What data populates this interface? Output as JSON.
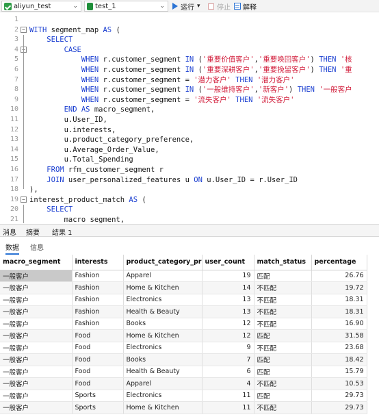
{
  "toolbar": {
    "connection": "aliyun_test",
    "database": "test_1",
    "run_label": "运行",
    "run_dropdown": "▾",
    "stop_label": "停止",
    "explain_label": "解释"
  },
  "editor": {
    "lines": [
      {
        "n": "1",
        "tokens": []
      },
      {
        "n": "2",
        "tokens": [
          {
            "t": "WITH",
            "c": "kw"
          },
          {
            "t": " segment_map ",
            "c": "plain"
          },
          {
            "t": "AS",
            "c": "kw"
          },
          {
            "t": " (",
            "c": "plain"
          }
        ]
      },
      {
        "n": "3",
        "tokens": [
          {
            "t": "    ",
            "c": "plain"
          },
          {
            "t": "SELECT",
            "c": "kw"
          }
        ]
      },
      {
        "n": "4",
        "tokens": [
          {
            "t": "        ",
            "c": "plain"
          },
          {
            "t": "CASE",
            "c": "kw"
          }
        ]
      },
      {
        "n": "5",
        "tokens": [
          {
            "t": "            ",
            "c": "plain"
          },
          {
            "t": "WHEN",
            "c": "kw"
          },
          {
            "t": " r.customer_segment ",
            "c": "plain"
          },
          {
            "t": "IN",
            "c": "kw"
          },
          {
            "t": " (",
            "c": "plain"
          },
          {
            "t": "'重要价值客户'",
            "c": "str"
          },
          {
            "t": ",",
            "c": "plain"
          },
          {
            "t": "'重要唤回客户'",
            "c": "str"
          },
          {
            "t": ") ",
            "c": "plain"
          },
          {
            "t": "THEN",
            "c": "kw"
          },
          {
            "t": " ",
            "c": "plain"
          },
          {
            "t": "'核",
            "c": "str"
          }
        ]
      },
      {
        "n": "6",
        "tokens": [
          {
            "t": "            ",
            "c": "plain"
          },
          {
            "t": "WHEN",
            "c": "kw"
          },
          {
            "t": " r.customer_segment ",
            "c": "plain"
          },
          {
            "t": "IN",
            "c": "kw"
          },
          {
            "t": " (",
            "c": "plain"
          },
          {
            "t": "'重要深耕客户'",
            "c": "str"
          },
          {
            "t": ",",
            "c": "plain"
          },
          {
            "t": "'重要挽留客户'",
            "c": "str"
          },
          {
            "t": ") ",
            "c": "plain"
          },
          {
            "t": "THEN",
            "c": "kw"
          },
          {
            "t": " ",
            "c": "plain"
          },
          {
            "t": "'重",
            "c": "str"
          }
        ]
      },
      {
        "n": "7",
        "tokens": [
          {
            "t": "            ",
            "c": "plain"
          },
          {
            "t": "WHEN",
            "c": "kw"
          },
          {
            "t": " r.customer_segment = ",
            "c": "plain"
          },
          {
            "t": "'潜力客户'",
            "c": "str"
          },
          {
            "t": " ",
            "c": "plain"
          },
          {
            "t": "THEN",
            "c": "kw"
          },
          {
            "t": " ",
            "c": "plain"
          },
          {
            "t": "'潜力客户'",
            "c": "str"
          }
        ]
      },
      {
        "n": "8",
        "tokens": [
          {
            "t": "            ",
            "c": "plain"
          },
          {
            "t": "WHEN",
            "c": "kw"
          },
          {
            "t": " r.customer_segment ",
            "c": "plain"
          },
          {
            "t": "IN",
            "c": "kw"
          },
          {
            "t": " (",
            "c": "plain"
          },
          {
            "t": "'一般维持客户'",
            "c": "str"
          },
          {
            "t": ",",
            "c": "plain"
          },
          {
            "t": "'新客户'",
            "c": "str"
          },
          {
            "t": ") ",
            "c": "plain"
          },
          {
            "t": "THEN",
            "c": "kw"
          },
          {
            "t": " ",
            "c": "plain"
          },
          {
            "t": "'一般客户",
            "c": "str"
          }
        ]
      },
      {
        "n": "9",
        "tokens": [
          {
            "t": "            ",
            "c": "plain"
          },
          {
            "t": "WHEN",
            "c": "kw"
          },
          {
            "t": " r.customer_segment = ",
            "c": "plain"
          },
          {
            "t": "'流失客户'",
            "c": "str"
          },
          {
            "t": " ",
            "c": "plain"
          },
          {
            "t": "THEN",
            "c": "kw"
          },
          {
            "t": " ",
            "c": "plain"
          },
          {
            "t": "'流失客户'",
            "c": "str"
          }
        ]
      },
      {
        "n": "10",
        "tokens": [
          {
            "t": "        ",
            "c": "plain"
          },
          {
            "t": "END AS",
            "c": "kw"
          },
          {
            "t": " macro_segment,",
            "c": "plain"
          }
        ]
      },
      {
        "n": "11",
        "tokens": [
          {
            "t": "        u.User_ID,",
            "c": "plain"
          }
        ]
      },
      {
        "n": "12",
        "tokens": [
          {
            "t": "        u.interests,",
            "c": "plain"
          }
        ]
      },
      {
        "n": "13",
        "tokens": [
          {
            "t": "        u.product_category_preference,",
            "c": "plain"
          }
        ]
      },
      {
        "n": "14",
        "tokens": [
          {
            "t": "        u.Average_Order_Value,",
            "c": "plain"
          }
        ]
      },
      {
        "n": "15",
        "tokens": [
          {
            "t": "        u.Total_Spending",
            "c": "plain"
          }
        ]
      },
      {
        "n": "16",
        "tokens": [
          {
            "t": "    ",
            "c": "plain"
          },
          {
            "t": "FROM",
            "c": "kw"
          },
          {
            "t": " rfm_customer_segment r",
            "c": "plain"
          }
        ]
      },
      {
        "n": "17",
        "tokens": [
          {
            "t": "    ",
            "c": "plain"
          },
          {
            "t": "JOIN",
            "c": "kw"
          },
          {
            "t": " user_personalized_features u ",
            "c": "plain"
          },
          {
            "t": "ON",
            "c": "kw"
          },
          {
            "t": " u.User_ID = r.User_ID",
            "c": "plain"
          }
        ]
      },
      {
        "n": "18",
        "tokens": [
          {
            "t": "),",
            "c": "plain"
          }
        ]
      },
      {
        "n": "19",
        "tokens": [
          {
            "t": "interest_product_match ",
            "c": "plain"
          },
          {
            "t": "AS",
            "c": "kw"
          },
          {
            "t": " (",
            "c": "plain"
          }
        ]
      },
      {
        "n": "20",
        "tokens": [
          {
            "t": "    ",
            "c": "plain"
          },
          {
            "t": "SELECT",
            "c": "kw"
          }
        ]
      },
      {
        "n": "21",
        "tokens": [
          {
            "t": "        macro_segment,",
            "c": "plain"
          }
        ]
      }
    ]
  },
  "result_tabs": [
    "消息",
    "摘要",
    "结果 1"
  ],
  "sub_tabs": [
    "数据",
    "信息"
  ],
  "grid": {
    "columns": [
      "macro_segment",
      "interests",
      "product_category_pr",
      "user_count",
      "match_status",
      "percentage"
    ],
    "rows": [
      [
        "一般客户",
        "Fashion",
        "Apparel",
        "19",
        "匹配",
        "26.76"
      ],
      [
        "一般客户",
        "Fashion",
        "Home & Kitchen",
        "14",
        "不匹配",
        "19.72"
      ],
      [
        "一般客户",
        "Fashion",
        "Electronics",
        "13",
        "不匹配",
        "18.31"
      ],
      [
        "一般客户",
        "Fashion",
        "Health & Beauty",
        "13",
        "不匹配",
        "18.31"
      ],
      [
        "一般客户",
        "Fashion",
        "Books",
        "12",
        "不匹配",
        "16.90"
      ],
      [
        "一般客户",
        "Food",
        "Home & Kitchen",
        "12",
        "匹配",
        "31.58"
      ],
      [
        "一般客户",
        "Food",
        "Electronics",
        "9",
        "不匹配",
        "23.68"
      ],
      [
        "一般客户",
        "Food",
        "Books",
        "7",
        "匹配",
        "18.42"
      ],
      [
        "一般客户",
        "Food",
        "Health & Beauty",
        "6",
        "匹配",
        "15.79"
      ],
      [
        "一般客户",
        "Food",
        "Apparel",
        "4",
        "不匹配",
        "10.53"
      ],
      [
        "一般客户",
        "Sports",
        "Electronics",
        "11",
        "匹配",
        "29.73"
      ],
      [
        "一般客户",
        "Sports",
        "Home & Kitchen",
        "11",
        "不匹配",
        "29.73"
      ]
    ]
  }
}
